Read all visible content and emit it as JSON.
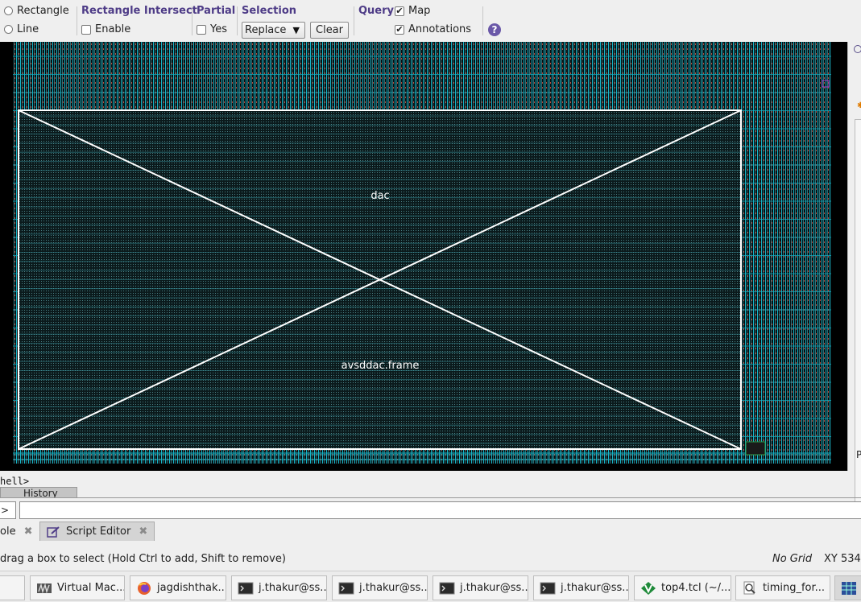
{
  "toolbar": {
    "mode_rectangle": "Rectangle",
    "mode_line": "Line",
    "intersect_title": "Rectangle Intersect",
    "intersect_enable": "Enable",
    "partial_title": "Partial",
    "partial_yes": "Yes",
    "selection_title": "Selection",
    "selection_value": "Replace",
    "clear_label": "Clear",
    "query_title": "Query",
    "map_label": "Map",
    "annotations_label": "Annotations",
    "help_glyph": "?"
  },
  "layout": {
    "cell_name": "dac",
    "frame_name": "avsddac.frame",
    "colors": {
      "background": "#000000",
      "routing": "#16b3c6",
      "frame": "#ffffff",
      "dense": "#5d8f94"
    }
  },
  "console": {
    "shell_prompt": "hell>",
    "history_tab": "History",
    "cmd_prompt": ">",
    "tabs": [
      {
        "label": "ole"
      },
      {
        "label": "Script Editor"
      }
    ]
  },
  "status": {
    "message": "drag a box to select (Hold Ctrl to add, Shift to remove)",
    "grid": "No Grid",
    "xy": "XY 534"
  },
  "taskbar": {
    "items": [
      {
        "label": "",
        "icon": "show-desktop-icon"
      },
      {
        "label": "Virtual Mac...",
        "icon": "virtual-machine-icon"
      },
      {
        "label": "jagdishthak...",
        "icon": "firefox-icon"
      },
      {
        "label": "j.thakur@ss...",
        "icon": "terminal-icon"
      },
      {
        "label": "j.thakur@ss...",
        "icon": "terminal-icon"
      },
      {
        "label": "j.thakur@ss...",
        "icon": "terminal-icon"
      },
      {
        "label": "j.thakur@ss...",
        "icon": "terminal-icon"
      },
      {
        "label": "top4.tcl (~/...",
        "icon": "vim-icon"
      },
      {
        "label": "timing_for...",
        "icon": "search-doc-icon"
      },
      {
        "label": "",
        "icon": "layout-app-icon"
      }
    ]
  }
}
